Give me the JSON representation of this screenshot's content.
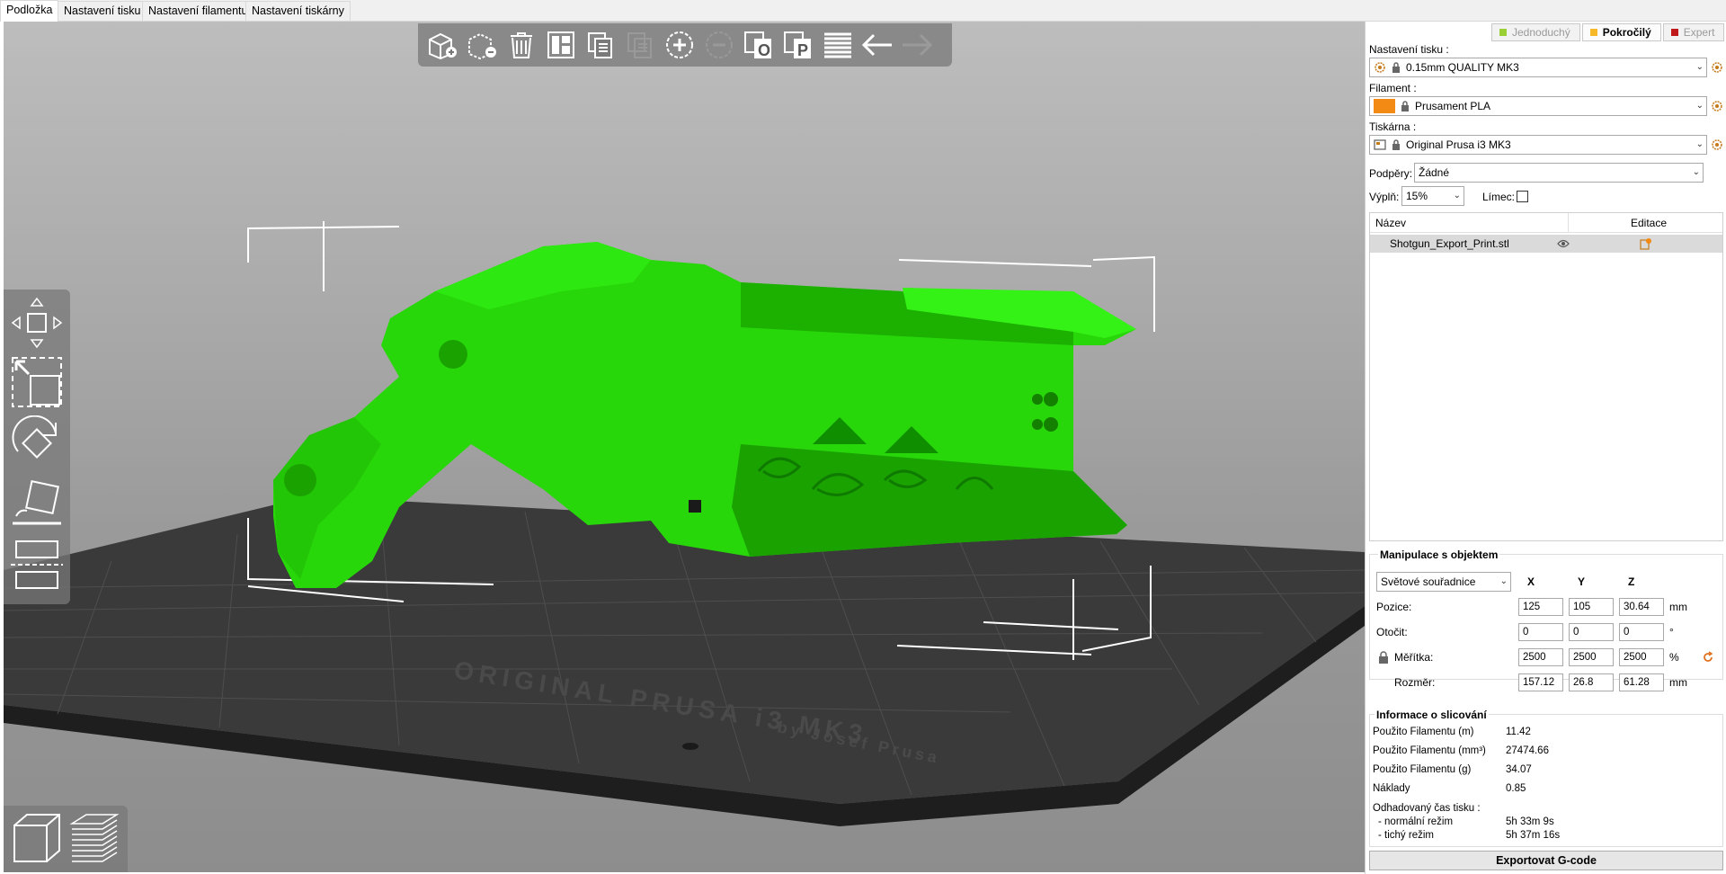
{
  "tabs": [
    "Podložka",
    "Nastavení tisku",
    "Nastavení filamentu",
    "Nastavení tiskárny"
  ],
  "modes": [
    {
      "label": "Jednoduchý",
      "color": "#9bd035"
    },
    {
      "label": "Pokročilý",
      "color": "#f5b92a"
    },
    {
      "label": "Expert",
      "color": "#c0191c"
    }
  ],
  "print_settings": {
    "label": "Nastavení tisku :",
    "value": "0.15mm QUALITY MK3"
  },
  "filament": {
    "label": "Filament :",
    "value": "Prusament PLA",
    "color": "#f28a14"
  },
  "printer": {
    "label": "Tiskárna :",
    "value": "Original Prusa i3 MK3"
  },
  "supports": {
    "label": "Podpěry:",
    "value": "Žádné"
  },
  "infill": {
    "label": "Výplň:",
    "value": "15%"
  },
  "brim": {
    "label": "Límec:"
  },
  "object_list": {
    "col_name": "Název",
    "col_edit": "Editace",
    "items": [
      {
        "name": "Shotgun_Export_Print.stl"
      }
    ]
  },
  "manipulation": {
    "title": "Manipulace s objektem",
    "coord_system": "Světové souřadnice",
    "axes": [
      "X",
      "Y",
      "Z"
    ],
    "rows": [
      {
        "label": "Pozice:",
        "values": [
          "125",
          "105",
          "30.64"
        ],
        "unit": "mm"
      },
      {
        "label": "Otočit:",
        "values": [
          "0",
          "0",
          "0"
        ],
        "unit": "°"
      },
      {
        "label": "Měřítka:",
        "values": [
          "2500",
          "2500",
          "2500"
        ],
        "unit": "%"
      },
      {
        "label": "Rozměr:",
        "values": [
          "157.12",
          "26.8",
          "61.28"
        ],
        "unit": "mm"
      }
    ]
  },
  "slice_info": {
    "title": "Informace o slicování",
    "rows": [
      {
        "label": "Použito Filamentu (m)",
        "value": "11.42"
      },
      {
        "label": "Použito Filamentu (mm³)",
        "value": "27474.66"
      },
      {
        "label": "Použito Filamentu (g)",
        "value": "34.07"
      },
      {
        "label": "Náklady",
        "value": "0.85"
      }
    ],
    "time_label": "Odhadovaný čas tisku :",
    "normal_label": "- normální režim",
    "normal_value": "5h 33m 9s",
    "silent_label": "- tichý režim",
    "silent_value": "5h 37m 16s"
  },
  "export_button": "Exportovat G-code",
  "bed": {
    "title": "ORIGINAL PRUSA i3 MK3",
    "subtitle": "by Josef Prusa"
  },
  "colors": {
    "model": "#22e000",
    "accent": "#f28a14"
  }
}
